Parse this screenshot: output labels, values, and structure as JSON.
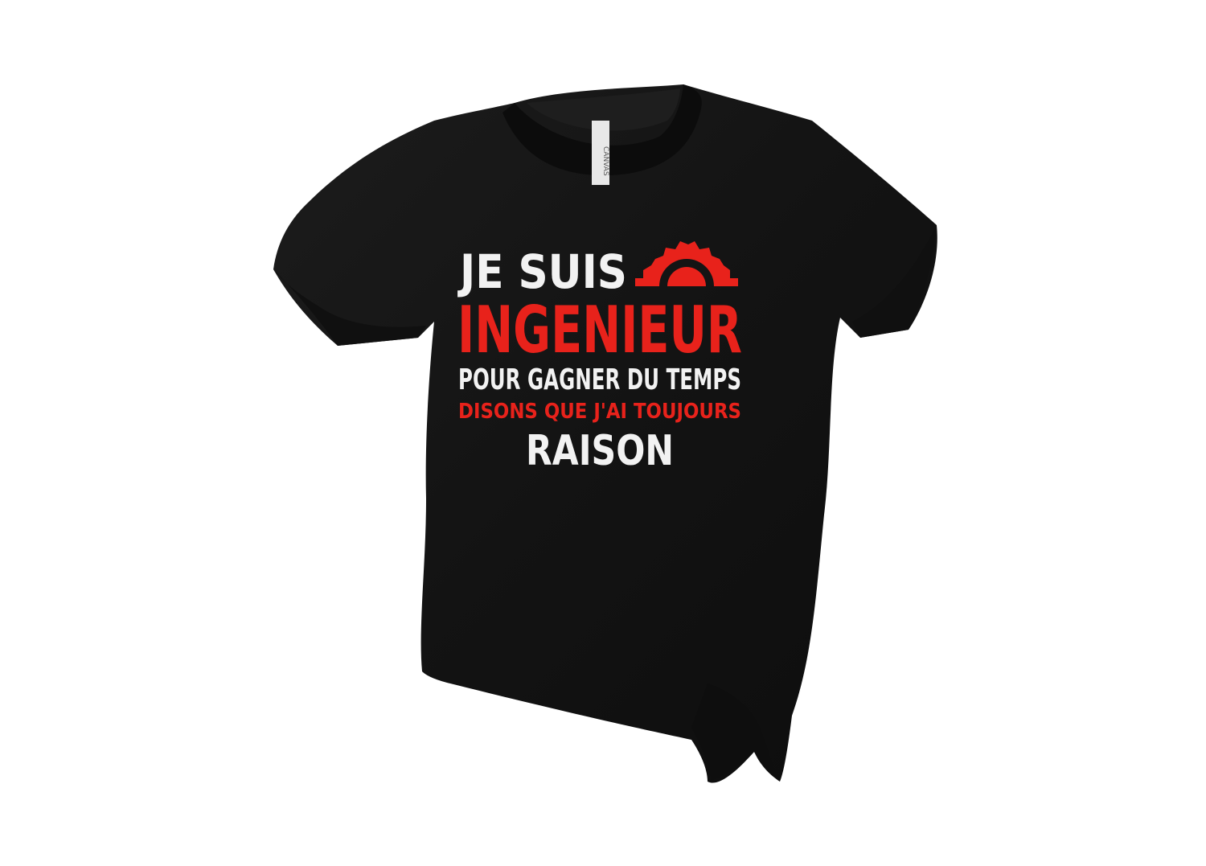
{
  "image": {
    "subject": "t-shirt",
    "shirt_color": "#141414",
    "background_color": "#ffffff"
  },
  "neck_label": {
    "brand": "CANVAS"
  },
  "print": {
    "line1": "JE SUIS",
    "line2": "INGENIEUR",
    "line3": "POUR GAGNER DU TEMPS",
    "line4": "DISONS QUE J'AI TOUJOURS",
    "line5": "RAISON",
    "white_color": "#f2f2f2",
    "red_color": "#e8221b",
    "icon": "gear-icon"
  }
}
